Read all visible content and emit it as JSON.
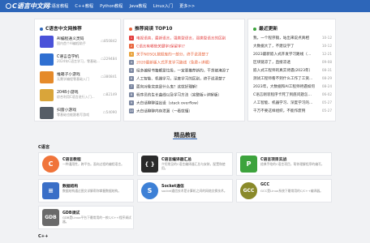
{
  "header": {
    "logo_text": "C语言中文网",
    "nav": [
      "C语言教程",
      "C++教程",
      "Python教程",
      "Java教程",
      "Linux入门",
      "更多>>"
    ]
  },
  "sites": {
    "title": "C语言中文网推荐",
    "items": [
      {
        "name": "AI编程通义灵码",
        "desc": "国内首个AI编程助手",
        "count": "850842",
        "color": "#4a52d9"
      },
      {
        "name": "C语言自学机",
        "desc": "2024年C语言学习，零基础...",
        "count": "229484",
        "color": "#2f6fd1"
      },
      {
        "name": "推箱子小游戏",
        "desc": "无需学编程零基础入门",
        "count": "380841",
        "color": "#e58a2a"
      },
      {
        "name": "2048小游戏",
        "desc": "综合利用C语言进行入门...",
        "count": "82149",
        "color": "#d9a53a"
      },
      {
        "name": "扫雷小游戏",
        "desc": "零基础也能跟着写游戏",
        "count": "54090",
        "color": "#555d66"
      }
    ]
  },
  "top10": {
    "title": "推荐阅读 TOP10",
    "items": [
      {
        "text": "电视语音，最新语言，强类型语言，弱类型语言的区别",
        "color": "#e23a3a",
        "num_color": "#e23a3a"
      },
      {
        "text": "C语言有哪些关键字(保留字)？",
        "color": "#e23a3a",
        "num_color": "#e8633a"
      },
      {
        "text": "关于NOSQL数据库的一部分，终于说清楚了",
        "color": "#e8633a",
        "num_color": "#e8a13a"
      },
      {
        "text": "2020最新版入式开发学习路线（免费+详细）",
        "color": "#e8633a",
        "num_color": "#7a86a0"
      },
      {
        "text": "经多编程书籍都是垃圾，一定要推荐新的，干货被淹没了",
        "color": "#333333",
        "num_color": "#7a86a0"
      },
      {
        "text": "人工智能、机器学习，深度学习的区别，终于说清楚了",
        "color": "#333333",
        "num_color": "#7a86a0"
      },
      {
        "text": "面向对象究竟是什么鬼？这就好理解！",
        "color": "#333333",
        "num_color": "#7a86a0"
      },
      {
        "text": "程序员的生长曲线以及学习方法（完整版+详解版）",
        "color": "#333333",
        "num_color": "#7a86a0"
      },
      {
        "text": "大白话聊聊溢出设（stack overflow）",
        "color": "#333333",
        "num_color": "#7a86a0"
      },
      {
        "text": "大白话聊聊内存泄漏（一看就懂）",
        "color": "#333333",
        "num_color": "#7a86a0"
      }
    ]
  },
  "latest": {
    "title": "最近更新",
    "items": [
      {
        "text": "我，一个程序猿，站出来说点真相",
        "date": "10-12"
      },
      {
        "text": "大数据大了，不建议学了",
        "date": "10-12"
      },
      {
        "text": "2023最新嵌入式开发学习路线（免费）",
        "date": "12-21"
      },
      {
        "text": "区块链凉了，直接凉透",
        "date": "09-08"
      },
      {
        "text": "嵌入式工程师的真实待遇(2023年）",
        "date": "08-31"
      },
      {
        "text": "测试工程师看不到什么工作了工资...",
        "date": "08-29"
      },
      {
        "text": "2023年，大数据和AI工程师待遇如何",
        "date": "08-24"
      },
      {
        "text": "C语言刚装程序卡死了到底问题怎么回事",
        "date": "06-02"
      },
      {
        "text": "人工智能、机器学习、深度学习的区别",
        "date": "05-27"
      },
      {
        "text": "千万不要这样组织，不能作废例",
        "date": "05-27"
      }
    ]
  },
  "tutorials": {
    "section_title": "精品教程",
    "subheads": [
      "C语言",
      "C++"
    ],
    "cards": [
      {
        "title": "C语言教程",
        "desc": "一种通用性，跨平台。面向过程的编程语言。",
        "icon": "C",
        "color": "#f0743a"
      },
      {
        "title": "C语言编译器汇总",
        "desc": "介绍常见的C语言编译器汇总与安装，配置和使用。",
        "icon": "{ }",
        "color": "#2a2a2a"
      },
      {
        "title": "C语言项目实战",
        "desc": "经典手绘的C语言项目，帮你理解程序的编写。",
        "icon": "P",
        "color": "#3da33d"
      },
      {
        "title": "数据结构",
        "desc": "数据结构通过图文详解帮你掌握数据结构。",
        "icon": "≡",
        "color": "#3a6fc7"
      },
      {
        "title": "Socket通信",
        "desc": "socket通信技术是计算机之间的网络交换技术。",
        "icon": "S",
        "color": "#3d80d6"
      },
      {
        "title": "GCC",
        "desc": "GCC是Linux系统下最常用的C/C++编译器。",
        "icon": "GCC",
        "color": "#8a8a2a"
      },
      {
        "title": "GDB调试",
        "desc": "GDB是Linux平台下最常用的一款C/C++程序调试器。",
        "icon": "GDB",
        "color": "#6a6a6a"
      }
    ]
  }
}
